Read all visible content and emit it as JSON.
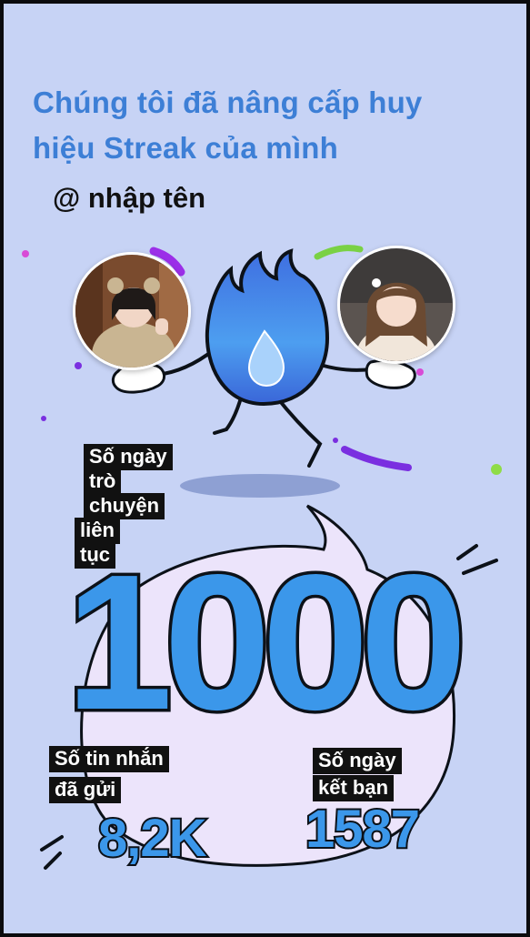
{
  "headline": "Chúng tôi đã nâng cấp huy hiệu Streak của mình",
  "username": "@ nhập tên",
  "streak": {
    "label_lines": [
      "Số ngày",
      "trò",
      "chuyện",
      "liên",
      "tục"
    ],
    "value": "1000"
  },
  "messages": {
    "label_lines": [
      "Số tin nhắn",
      "đã gửi"
    ],
    "value": "8,2K"
  },
  "friends": {
    "label_lines": [
      "Số ngày",
      "kết bạn"
    ],
    "value": "1587"
  },
  "colors": {
    "background": "#c7d3f5",
    "headline": "#3d7fd6",
    "number_fill": "#3b97ea",
    "label_bg": "#111111"
  }
}
